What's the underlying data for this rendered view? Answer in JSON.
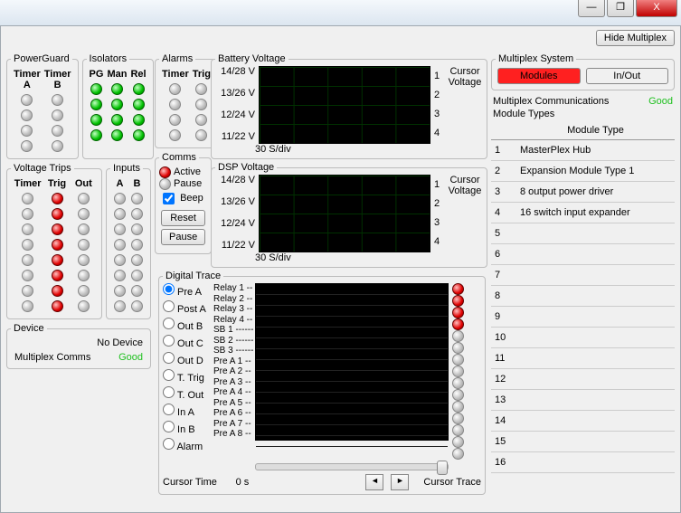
{
  "window": {
    "hide_btn": "Hide Multiplex",
    "min": "—",
    "max": "❐",
    "close": "X"
  },
  "powerguard": {
    "title": "PowerGuard",
    "col_a": "Timer A",
    "col_b": "Timer B"
  },
  "isolators": {
    "title": "Isolators",
    "cols": [
      "PG",
      "Man",
      "Rel"
    ]
  },
  "volttrips": {
    "title": "Voltage Trips",
    "cols": [
      "Timer",
      "Trig",
      "Out"
    ]
  },
  "inputs": {
    "title": "Inputs",
    "cols": [
      "A",
      "B"
    ]
  },
  "device": {
    "title": "Device",
    "value": "No Device",
    "comms_label": "Multiplex Comms",
    "comms_value": "Good"
  },
  "alarms": {
    "title": "Alarms",
    "cols": [
      "Timer",
      "Trig"
    ]
  },
  "comms": {
    "title": "Comms",
    "active": "Active",
    "pause_r": "Pause",
    "beep": "Beep",
    "reset": "Reset",
    "pause": "Pause"
  },
  "batt": {
    "title": "Battery Voltage",
    "cursor": "Cursor\nVoltage",
    "y": [
      "14/28 V",
      "13/26 V",
      "12/24 V",
      "11/22 V"
    ],
    "r": [
      "1",
      "2",
      "3",
      "4"
    ],
    "x": "30 S/div"
  },
  "dsp": {
    "title": "DSP Voltage",
    "cursor": "Cursor\nVoltage",
    "y": [
      "14/28 V",
      "13/26 V",
      "12/24 V",
      "11/22 V"
    ],
    "r": [
      "1",
      "2",
      "3",
      "4"
    ],
    "x": "30 S/div"
  },
  "dtrace": {
    "title": "Digital Trace",
    "options": [
      "Pre A",
      "Post A",
      "Out B",
      "Out C",
      "Out D",
      "T. Trig",
      "T. Out",
      "In A",
      "In B",
      "Alarm"
    ],
    "selected": 0,
    "relays": [
      "Relay 1 --",
      "Relay 2 --",
      "Relay 3 --",
      "Relay 4 --",
      "SB 1 ------",
      "SB 2 ------",
      "SB 3 ------",
      "Pre A 1 --",
      "Pre A 2 --",
      "Pre A 3 --",
      "Pre A 4 --",
      "Pre A 5 --",
      "Pre A 6 --",
      "Pre A 7 --",
      "Pre A 8 --"
    ],
    "red_indices": [
      0,
      1,
      2,
      3
    ]
  },
  "cursor": {
    "time_lbl": "Cursor Time",
    "time_val": "0 s",
    "trace_lbl": "Cursor Trace",
    "left": "◄",
    "right": "►"
  },
  "multiplex": {
    "system_title": "Multiplex System",
    "modules_btn": "Modules",
    "inout_btn": "In/Out",
    "comms_title": "Multiplex Communications",
    "comms_val": "Good",
    "types_title": "Module Types",
    "col_header": "Module Type",
    "rows": [
      {
        "n": "1",
        "name": "MasterPlex Hub"
      },
      {
        "n": "2",
        "name": "Expansion Module Type 1"
      },
      {
        "n": "3",
        "name": "8 output power driver"
      },
      {
        "n": "4",
        "name": "16 switch input expander"
      },
      {
        "n": "5",
        "name": ""
      },
      {
        "n": "6",
        "name": ""
      },
      {
        "n": "7",
        "name": ""
      },
      {
        "n": "8",
        "name": ""
      },
      {
        "n": "9",
        "name": ""
      },
      {
        "n": "10",
        "name": ""
      },
      {
        "n": "11",
        "name": ""
      },
      {
        "n": "12",
        "name": ""
      },
      {
        "n": "13",
        "name": ""
      },
      {
        "n": "14",
        "name": ""
      },
      {
        "n": "15",
        "name": ""
      },
      {
        "n": "16",
        "name": ""
      }
    ]
  }
}
